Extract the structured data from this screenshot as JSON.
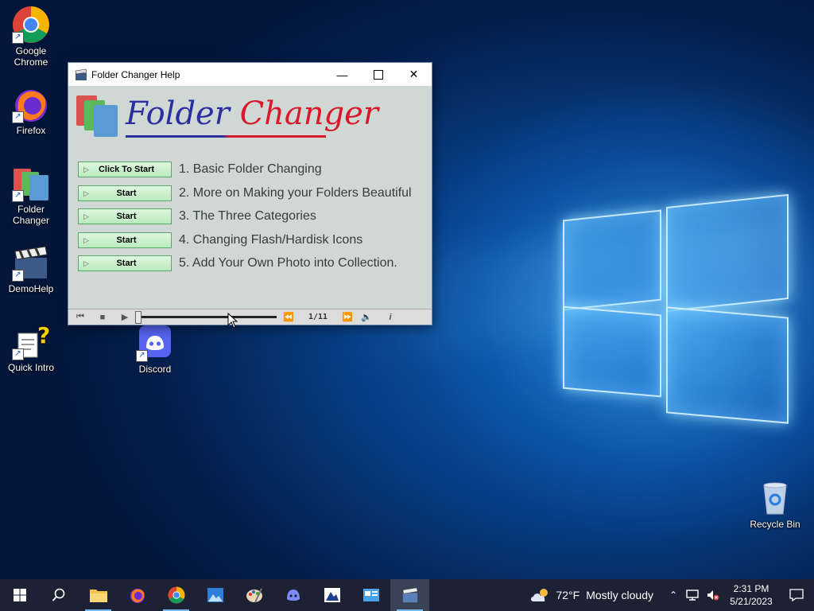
{
  "desktop": {
    "icons": [
      {
        "label": "Google Chrome",
        "icon": "chrome-icon"
      },
      {
        "label": "Firefox",
        "icon": "firefox-icon"
      },
      {
        "label": "Folder Changer",
        "icon": "folder-changer-icon"
      },
      {
        "label": "DemoHelp",
        "icon": "clapper-icon"
      },
      {
        "label": "Quick Intro",
        "icon": "help-document-icon"
      },
      {
        "label": "Discord",
        "icon": "discord-icon"
      },
      {
        "label": "Recycle Bin",
        "icon": "recycle-bin-icon"
      }
    ]
  },
  "window": {
    "title": "Folder Changer Help",
    "logo": {
      "word1": "Folder",
      "word2": "Changer"
    },
    "lessons": [
      {
        "button": "Click To Start",
        "text": "1. Basic Folder Changing"
      },
      {
        "button": "Start",
        "text": "2. More on Making your Folders Beautiful"
      },
      {
        "button": "Start",
        "text": "3. The Three Categories"
      },
      {
        "button": "Start",
        "text": "4. Changing Flash/Hardisk Icons"
      },
      {
        "button": "Start",
        "text": "5. Add Your Own Photo into Collection."
      }
    ],
    "player": {
      "counter": "1/11",
      "progress_fraction": 0.0,
      "info": "i"
    }
  },
  "taskbar": {
    "weather": {
      "temp": "72°F",
      "desc": "Mostly cloudy"
    },
    "time": "2:31 PM",
    "date": "5/21/2023"
  },
  "colors": {
    "logo_blue": "#2a2fa0",
    "logo_red": "#d8192a",
    "button_green": "#b9ebbd",
    "taskbar": "#1c2233"
  }
}
